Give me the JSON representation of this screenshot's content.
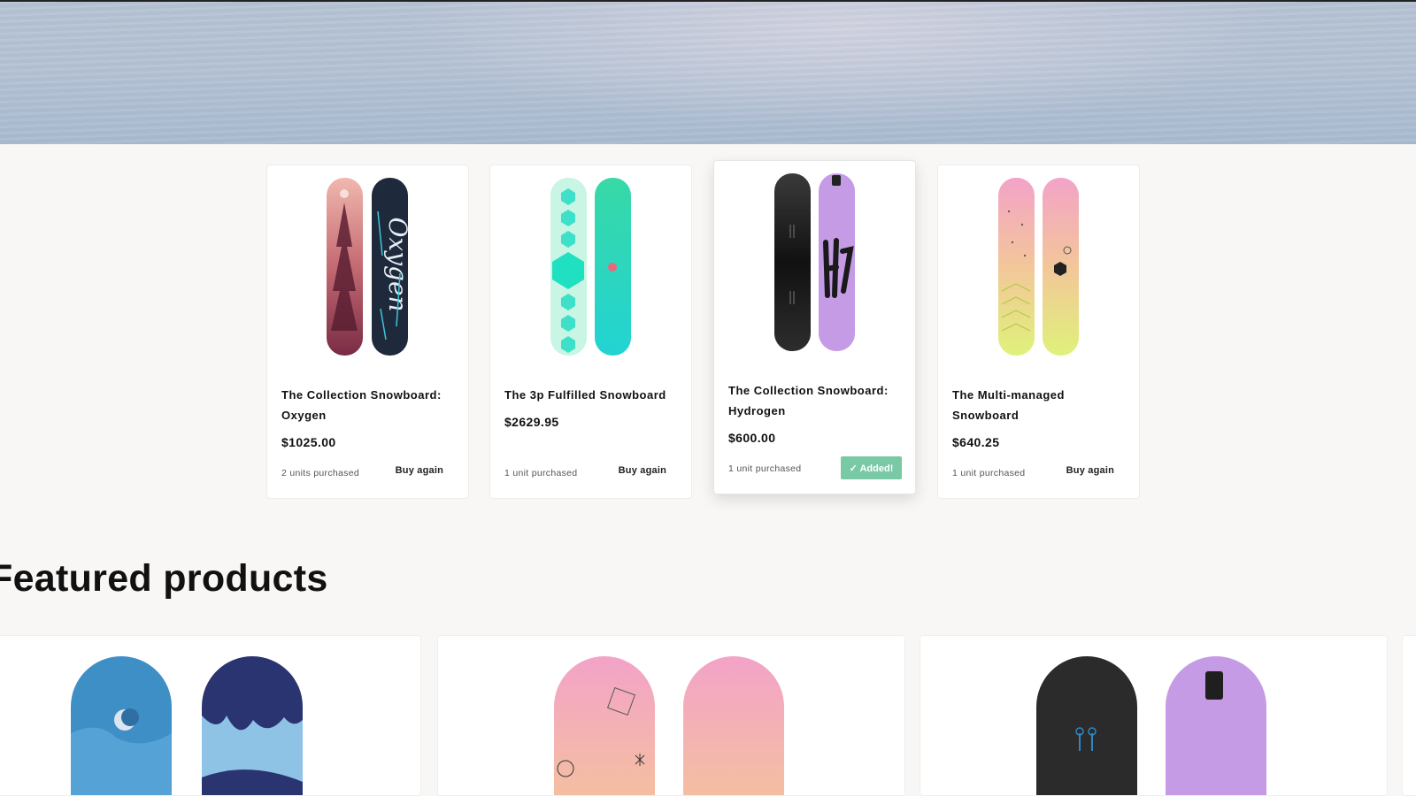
{
  "previous_purchases": [
    {
      "title": "The Collection Snowboard: Oxygen",
      "price": "$1025.00",
      "units": "2 units purchased",
      "action": "Buy again"
    },
    {
      "title": "The 3p Fulfilled Snowboard",
      "price": "$2629.95",
      "units": "1 unit purchased",
      "action": "Buy again"
    },
    {
      "title": "The Collection Snowboard: Hydrogen",
      "price": "$600.00",
      "units": "1 unit purchased",
      "action": "✓ Added!"
    },
    {
      "title": "The Multi-managed Snowboard",
      "price": "$640.25",
      "units": "1 unit purchased",
      "action": "Buy again"
    }
  ],
  "featured": {
    "heading": "Featured products"
  },
  "colors": {
    "added_button": "#79c9a6",
    "page_background": "#f8f7f5"
  }
}
